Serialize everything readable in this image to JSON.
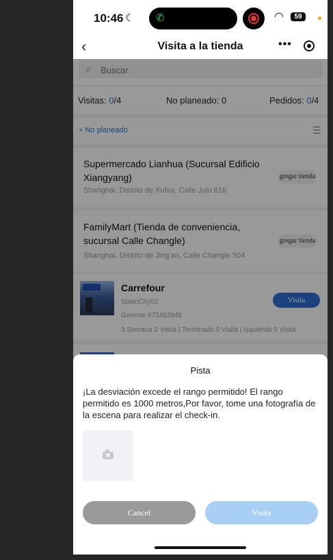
{
  "status_bar": {
    "time": "10:46",
    "battery": "59"
  },
  "nav": {
    "title": "Visita a la tienda",
    "more": "•••"
  },
  "search": {
    "placeholder": "Buscar"
  },
  "stats": {
    "visits_label": "Visitas:",
    "visits_done": "0",
    "visits_total": "/4",
    "unplanned_label": "No planeado:",
    "unplanned_value": "0",
    "orders_label": "Pedidos:",
    "orders_done": "0",
    "orders_total": "/4"
  },
  "unplanned_link": "+ No planeado",
  "stores": [
    {
      "name": "Supermercado Lianhua (Sucursal Edificio Xiangyang)",
      "address": "Shanghai, Distrito de Xuhui, Calle Julu 616",
      "button": "gregar tienda"
    },
    {
      "name": "FamilyMart (Tienda de conveniencia, sucursal Calle Changle)",
      "address": "Shanghai, Distrito de Jing'an, Calle Changle 504",
      "button": "gregar tienda"
    },
    {
      "name": "Carrefour",
      "code": "SpainCity02",
      "manager": "Gerente 673462946",
      "summary": "3 Semana 2 Visita | Terminado 0 Visita | Izquierda 0 Visita",
      "button": "Visita"
    }
  ],
  "dialog": {
    "title": "Pista",
    "message": "¡La desviación excede el rango permitido! El rango permitido es 1000 metros,Por favor, tome una fotografía de la escena para realizar el check-in.",
    "cancel": "Cancel",
    "confirm": "Visita"
  },
  "colors": {
    "accent": "#2f6fd1",
    "cancel_button": "#9a9a9a",
    "confirm_button_disabled": "#a9cff5"
  }
}
